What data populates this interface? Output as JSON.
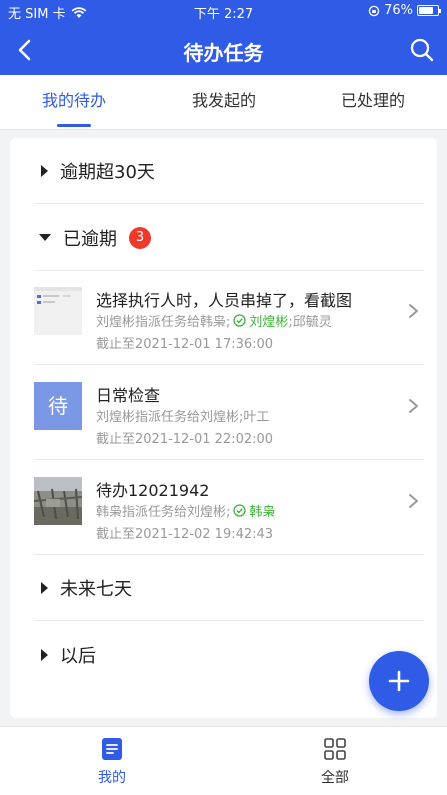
{
  "status": {
    "carrier": "无 SIM 卡",
    "time": "下午 2:27",
    "battery": "76%"
  },
  "header": {
    "title": "待办任务"
  },
  "tabs": [
    {
      "label": "我的待办",
      "active": true
    },
    {
      "label": "我发起的",
      "active": false
    },
    {
      "label": "已处理的",
      "active": false
    }
  ],
  "sections": {
    "overdue30": {
      "label": "逾期超30天",
      "expanded": false
    },
    "overdue": {
      "label": "已逾期",
      "count": "3",
      "expanded": true
    },
    "next7": {
      "label": "未来七天",
      "expanded": false
    },
    "later": {
      "label": "以后",
      "expanded": false
    }
  },
  "tasks": [
    {
      "title": "选择执行人时，人员串掉了，看截图",
      "assign_prefix": "刘煌彬指派任务给韩枭;",
      "assign_done": "刘煌彬",
      "assign_suffix": ";邱毓灵",
      "deadline": "截止至2021-12-01 17:36:00",
      "thumb": "screenshot"
    },
    {
      "title": "日常检查",
      "assign_prefix": "刘煌彬指派任务给刘煌彬;叶工",
      "assign_done": "",
      "assign_suffix": "",
      "deadline": "截止至2021-12-01 22:02:00",
      "thumb_text": "待"
    },
    {
      "title": "待办12021942",
      "assign_prefix": "韩枭指派任务给刘煌彬;",
      "assign_done": "韩枭",
      "assign_suffix": "",
      "deadline": "截止至2021-12-02 19:42:43",
      "thumb": "photo"
    }
  ],
  "bottom_nav": [
    {
      "label": "我的",
      "active": true
    },
    {
      "label": "全部",
      "active": false
    }
  ],
  "colors": {
    "primary": "#2f5be7",
    "badge": "#ef3a2b",
    "done": "#3cb43a"
  }
}
